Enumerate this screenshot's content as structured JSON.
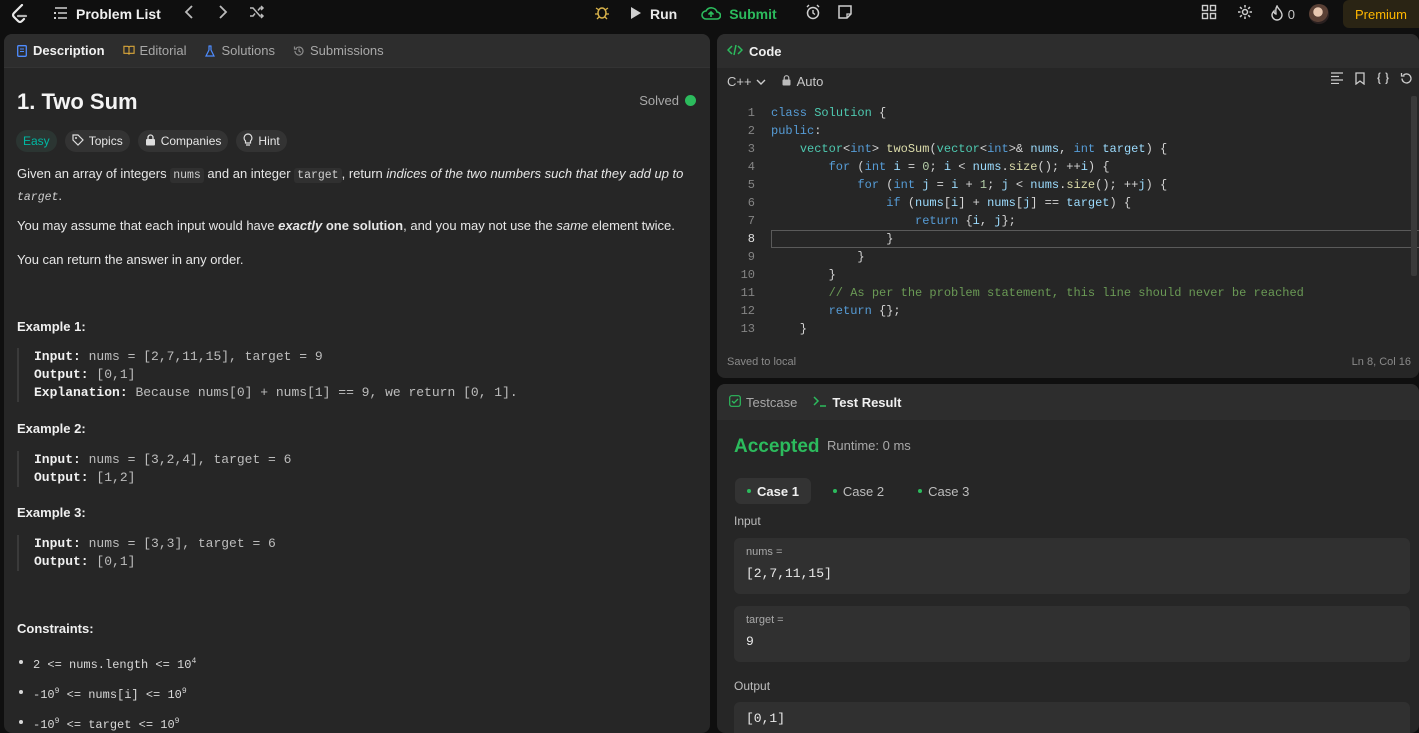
{
  "topbar": {
    "problem_list": "Problem List",
    "run": "Run",
    "submit": "Submit",
    "streak_count": "0",
    "premium": "Premium"
  },
  "description": {
    "tabs": [
      "Description",
      "Editorial",
      "Solutions",
      "Submissions"
    ],
    "title": "1. Two Sum",
    "status": "Solved",
    "difficulty": "Easy",
    "chips": [
      "Topics",
      "Companies",
      "Hint"
    ],
    "p1": {
      "a": "Given an array of integers ",
      "nums": "nums",
      "b": " and an integer ",
      "target": "target",
      "c": ", return ",
      "em": "indices of the two numbers such that they add up to",
      "target2": "target",
      "d": "."
    },
    "p2": {
      "a": "You may assume that each input would have ",
      "em": "exactly",
      "b": " one solution",
      "c": ", and you may not use the ",
      "same": "same",
      "d": " element twice."
    },
    "p3": "You can return the answer in any order.",
    "examples": [
      {
        "head": "Example 1:",
        "input_label": "Input:",
        "input": "nums = [2,7,11,15], target = 9",
        "output_label": "Output:",
        "output": "[0,1]",
        "expl_label": "Explanation:",
        "expl": "Because nums[0] + nums[1] == 9, we return [0, 1]."
      },
      {
        "head": "Example 2:",
        "input_label": "Input:",
        "input": "nums = [3,2,4], target = 6",
        "output_label": "Output:",
        "output": "[1,2]"
      },
      {
        "head": "Example 3:",
        "input_label": "Input:",
        "input": "nums = [3,3], target = 6",
        "output_label": "Output:",
        "output": "[0,1]"
      }
    ],
    "constraints_head": "Constraints:",
    "constraints": [
      {
        "a": "2 <= nums.length <= 10",
        "sup": "4"
      },
      {
        "a": "-10",
        "sup": "9",
        "b": " <= nums[i] <= 10",
        "sup2": "9"
      },
      {
        "a": "-10",
        "sup": "9",
        "b": " <= target <= 10",
        "sup2": "9"
      }
    ]
  },
  "code": {
    "tab": "Code",
    "language": "C++",
    "mode": "Auto",
    "line_numbers": [
      "1",
      "2",
      "3",
      "4",
      "5",
      "6",
      "7",
      "8",
      "9",
      "10",
      "11",
      "12",
      "13"
    ],
    "comment": "// As per the problem statement, this line should never be reached",
    "saved": "Saved to local",
    "cursor": "Ln 8, Col 16"
  },
  "result": {
    "tabs": [
      "Testcase",
      "Test Result"
    ],
    "status": "Accepted",
    "runtime": "Runtime: 0 ms",
    "cases": [
      "Case 1",
      "Case 2",
      "Case 3"
    ],
    "input_label": "Input",
    "nums_label": "nums =",
    "nums_value": "[2,7,11,15]",
    "target_label": "target =",
    "target_value": "9",
    "output_label": "Output",
    "output_value": "[0,1]"
  },
  "colors": {
    "accent_green": "#2cbb5d",
    "easy": "#00b8a3",
    "premium": "#ffb800"
  },
  "icons": [
    "leetcode-logo-icon",
    "list-icon",
    "chevron-left-icon",
    "chevron-right-icon",
    "shuffle-icon",
    "debug-icon",
    "play-icon",
    "cloud-upload-icon",
    "alarm-icon",
    "note-icon",
    "layout-icon",
    "gear-icon",
    "fire-icon"
  ]
}
